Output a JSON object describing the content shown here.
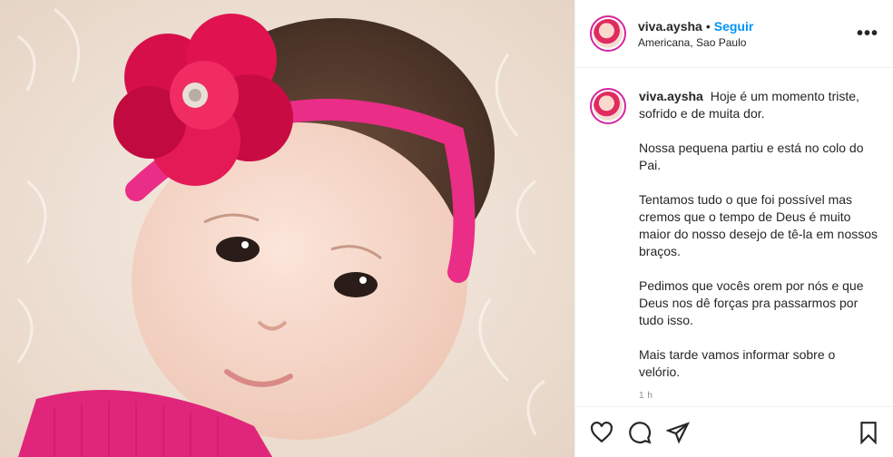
{
  "post": {
    "username": "viva.aysha",
    "separator": "•",
    "follow_label": "Seguir",
    "location": "Americana, Sao Paulo",
    "more_label": "•••",
    "caption_paragraphs": [
      "Hoje é um momento triste, sofrido e de muita dor.",
      "Nossa pequena partiu e está no colo do Pai.",
      "Tentamos tudo o que foi possível mas cremos que o tempo de Deus é muito maior do nosso desejo de tê-la em nossos braços.",
      "Pedimos que vocês orem por nós e que Deus nos dê forças pra passarmos por tudo isso.",
      "Mais tarde vamos informar sobre o velório."
    ],
    "timestamp": "1 h"
  },
  "icons": {
    "more": "more-options-icon",
    "like": "heart-icon",
    "comment": "comment-icon",
    "share": "share-icon",
    "save": "bookmark-icon"
  },
  "colors": {
    "follow": "#0095f6",
    "avatar_ring": "#d6249f",
    "flower": "#e0124f",
    "headband": "#ea2d86"
  }
}
